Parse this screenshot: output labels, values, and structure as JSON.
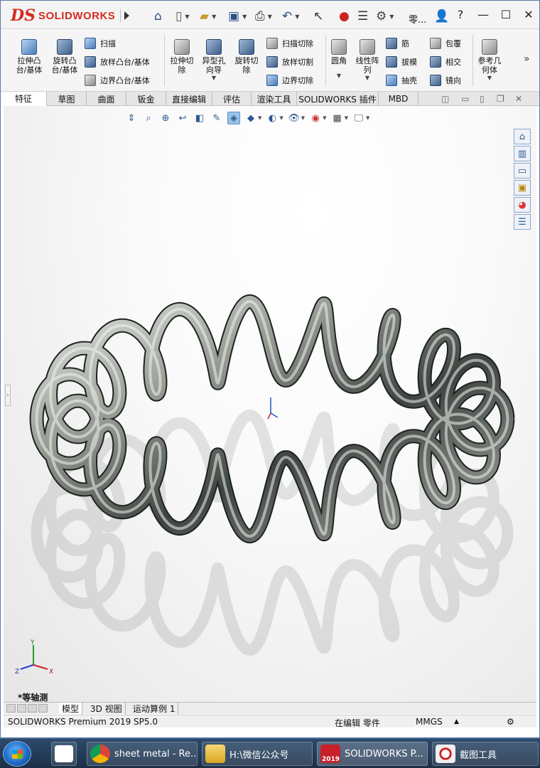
{
  "menubar": {
    "brand": "SOLIDWORKS",
    "brand_mark": "DS",
    "label_part": "零...",
    "controls": {
      "help": "?",
      "minimize": "—",
      "maximize": "☐",
      "close": "✕"
    }
  },
  "commands": {
    "extrude_boss": "拉伸凸\n台/基体",
    "revolve_boss": "旋转凸\n台/基体",
    "sweep": "扫描",
    "loft_boss": "放样凸台/基体",
    "boundary_boss": "边界凸台/基体",
    "extrude_cut": "拉伸切\n除",
    "hole_wizard": "异型孔\n向导",
    "revolve_cut": "旋转切\n除",
    "swept_cut": "扫描切除",
    "lofted_cut": "放样切割",
    "boundary_cut": "边界切除",
    "fillet": "圆角",
    "linear_pattern": "线性阵\n列",
    "rib": "筋",
    "draft": "拔模",
    "shell": "抽壳",
    "wrap": "包覆",
    "intersect": "相交",
    "mirror": "镜向",
    "reference_geometry": "参考几\n何体",
    "more": "»"
  },
  "tabs": [
    "特征",
    "草图",
    "曲面",
    "钣金",
    "直接编辑",
    "评估",
    "渲染工具",
    "SOLIDWORKS 插件",
    "MBD"
  ],
  "active_tab": "特征",
  "viewport": {
    "view_label": "*等轴测",
    "triad": {
      "x": "X",
      "y": "Y",
      "z": "Z"
    }
  },
  "bottom_tabs": [
    "模型",
    "3D 视图",
    "运动算例 1"
  ],
  "active_bottom_tab": "模型",
  "status": {
    "product": "SOLIDWORKS Premium 2019 SP5.0",
    "mode": "在编辑 零件",
    "units": "MMGS"
  },
  "taskbar": {
    "items": [
      {
        "label": "sheet metal - Re...",
        "icon": "chrome-icon"
      },
      {
        "label": "H:\\微信公众号",
        "icon": "folder-icon"
      },
      {
        "label": "SOLIDWORKS P...",
        "icon": "solidworks-icon",
        "badge": "2019"
      },
      {
        "label": "截图工具",
        "icon": "snipping-tool-icon"
      }
    ]
  },
  "colors": {
    "brand_red": "#d52b1e",
    "accent_blue": "#2b5a94",
    "coil_metal": "#8e948c"
  }
}
